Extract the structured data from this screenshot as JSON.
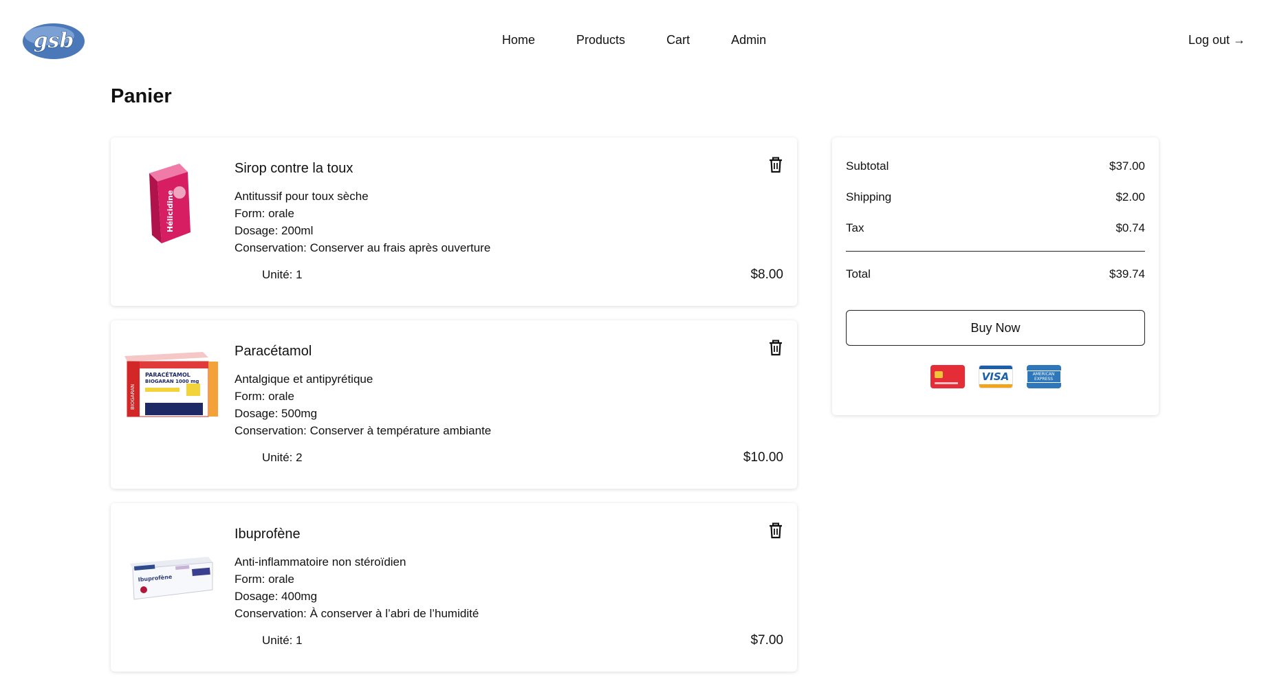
{
  "header": {
    "logo_text": "gsb",
    "nav": [
      "Home",
      "Products",
      "Cart",
      "Admin"
    ],
    "logout": "Log out →"
  },
  "page_title": "Panier",
  "cart_items": [
    {
      "name": "Sirop contre la toux",
      "description": "Antitussif pour toux sèche",
      "form": "Form: orale",
      "dosage": "Dosage: 200ml",
      "conservation": "Conservation: Conserver au frais après ouverture",
      "quantity": "Unité: 1",
      "price": "$8.00",
      "image_text": "Hélicidine",
      "icon": "trash-icon"
    },
    {
      "name": "Paracétamol",
      "description": "Antalgique et antipyrétique",
      "form": "Form: orale",
      "dosage": "Dosage: 500mg",
      "conservation": "Conservation: Conserver à température ambiante",
      "quantity": "Unité: 2",
      "price": "$10.00",
      "image_text": "PARACÉTAMOL BIOGARAN 1000 mg",
      "icon": "trash-icon"
    },
    {
      "name": "Ibuprofène",
      "description": "Anti-inflammatoire non stéroïdien",
      "form": "Form: orale",
      "dosage": "Dosage: 400mg",
      "conservation": "Conservation: À conserver à l’abri de l’humidité",
      "quantity": "Unité: 1",
      "price": "$7.00",
      "image_text": "Ibuprofène Viatris 200 mg",
      "icon": "trash-icon"
    }
  ],
  "summary": {
    "subtotal_label": "Subtotal",
    "subtotal": "$37.00",
    "shipping_label": "Shipping",
    "shipping": "$2.00",
    "tax_label": "Tax",
    "tax": "$0.74",
    "total_label": "Total",
    "total": "$39.74",
    "buy_label": "Buy Now",
    "payment_cards": [
      "credit-card-icon",
      "visa-icon",
      "amex-icon"
    ],
    "visa_text": "VISA",
    "amex_text": "AMERICAN EXPRESS"
  },
  "colors": {
    "logo_blue": "#4a78b8",
    "card_red": "#e42d36",
    "visa_blue": "#1a5fa8",
    "amex_blue": "#2e77bb"
  }
}
